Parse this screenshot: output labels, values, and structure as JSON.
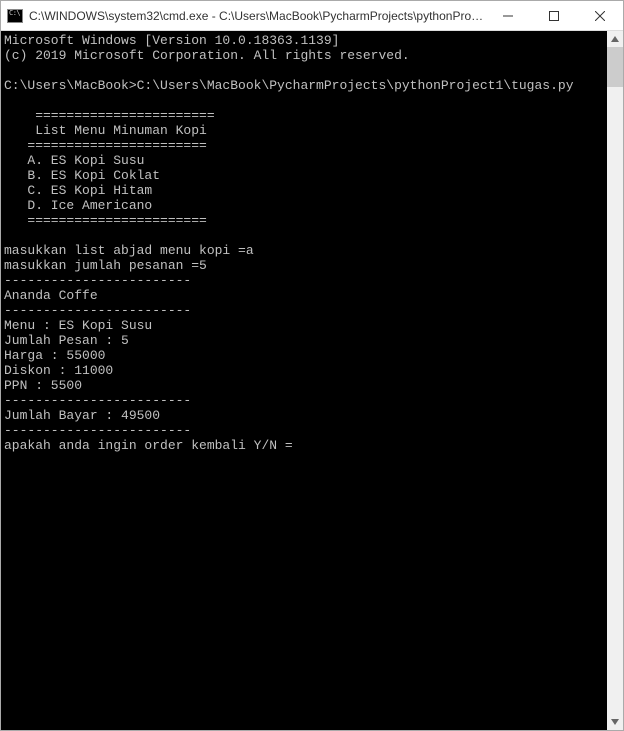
{
  "window": {
    "title": "C:\\WINDOWS\\system32\\cmd.exe - C:\\Users\\MacBook\\PycharmProjects\\pythonProject1..."
  },
  "console": {
    "line01": "Microsoft Windows [Version 10.0.18363.1139]",
    "line02": "(c) 2019 Microsoft Corporation. All rights reserved.",
    "line03": "",
    "line04": "C:\\Users\\MacBook>C:\\Users\\MacBook\\PycharmProjects\\pythonProject1\\tugas.py",
    "line05": "",
    "line06": "    =======================",
    "line07": "    List Menu Minuman Kopi",
    "line08": "   =======================",
    "line09": "   A. ES Kopi Susu",
    "line10": "   B. ES Kopi Coklat",
    "line11": "   C. ES Kopi Hitam",
    "line12": "   D. Ice Americano",
    "line13": "   =======================",
    "line14": "",
    "line15": "masukkan list abjad menu kopi =a",
    "line16": "masukkan jumlah pesanan =5",
    "line17": "------------------------",
    "line18": "Ananda Coffe",
    "line19": "------------------------",
    "line20": "Menu : ES Kopi Susu",
    "line21": "Jumlah Pesan : 5",
    "line22": "Harga : 55000",
    "line23": "Diskon : 11000",
    "line24": "PPN : 5500",
    "line25": "------------------------",
    "line26": "Jumlah Bayar : 49500",
    "line27": "------------------------",
    "line28": "apakah anda ingin order kembali Y/N ="
  }
}
